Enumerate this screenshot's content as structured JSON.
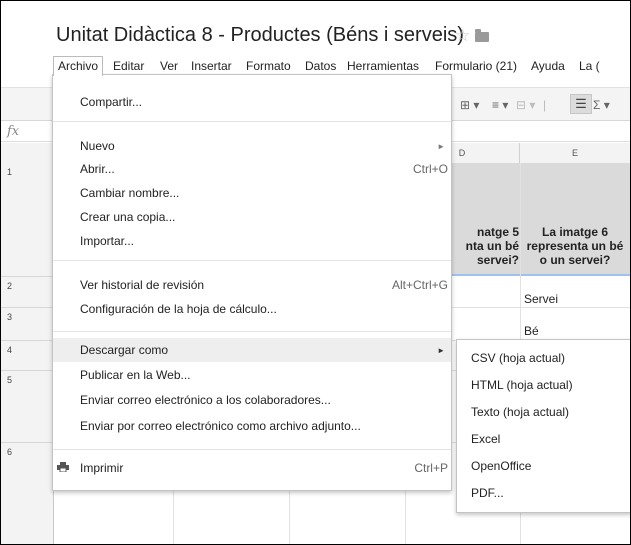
{
  "document": {
    "title": "Unitat Didàctica 8 - Productes (Béns i serveis)"
  },
  "menubar": [
    {
      "label": "Archivo"
    },
    {
      "label": "Editar"
    },
    {
      "label": "Ver"
    },
    {
      "label": "Insertar"
    },
    {
      "label": "Formato"
    },
    {
      "label": "Datos"
    },
    {
      "label": "Herramientas"
    },
    {
      "label": "Formulario (21)"
    },
    {
      "label": "Ayuda"
    },
    {
      "label": "La ("
    }
  ],
  "archivo_menu": [
    {
      "label": "Compartir..."
    },
    {
      "label": "Nuevo"
    },
    {
      "label": "Abrir...",
      "shortcut": "Ctrl+O"
    },
    {
      "label": "Cambiar nombre..."
    },
    {
      "label": "Crear una copia..."
    },
    {
      "label": "Importar..."
    },
    {
      "label": "Ver historial de revisión",
      "shortcut": "Alt+Ctrl+G"
    },
    {
      "label": "Configuración de la hoja de cálculo..."
    },
    {
      "label": "Descargar como"
    },
    {
      "label": "Publicar en la Web..."
    },
    {
      "label": "Enviar correo electrónico a los colaboradores..."
    },
    {
      "label": "Enviar por correo electrónico como archivo adjunto..."
    },
    {
      "label": "Imprimir",
      "shortcut": "Ctrl+P"
    }
  ],
  "download_submenu": [
    {
      "label": "CSV (hoja actual)"
    },
    {
      "label": "HTML (hoja actual)"
    },
    {
      "label": "Texto (hoja actual)"
    },
    {
      "label": "Excel"
    },
    {
      "label": "OpenOffice"
    },
    {
      "label": "PDF..."
    }
  ],
  "grid": {
    "columns": [
      "D",
      "E"
    ],
    "rows": [
      "1",
      "2",
      "3",
      "4",
      "5",
      "6"
    ],
    "col_d_header": [
      "natge 5",
      "nta un bé",
      "servei?"
    ],
    "col_e_header": [
      "La imatge 6",
      "representa un bé",
      "o un servei?"
    ],
    "cells": {
      "e2": "Servei",
      "e3": "Bé"
    }
  },
  "formula_icon": "fx",
  "icons": [
    "star-icon",
    "folder-icon",
    "print-icon",
    "submenu-arrow-icon",
    "wrap-text-icon",
    "sigma-icon"
  ]
}
